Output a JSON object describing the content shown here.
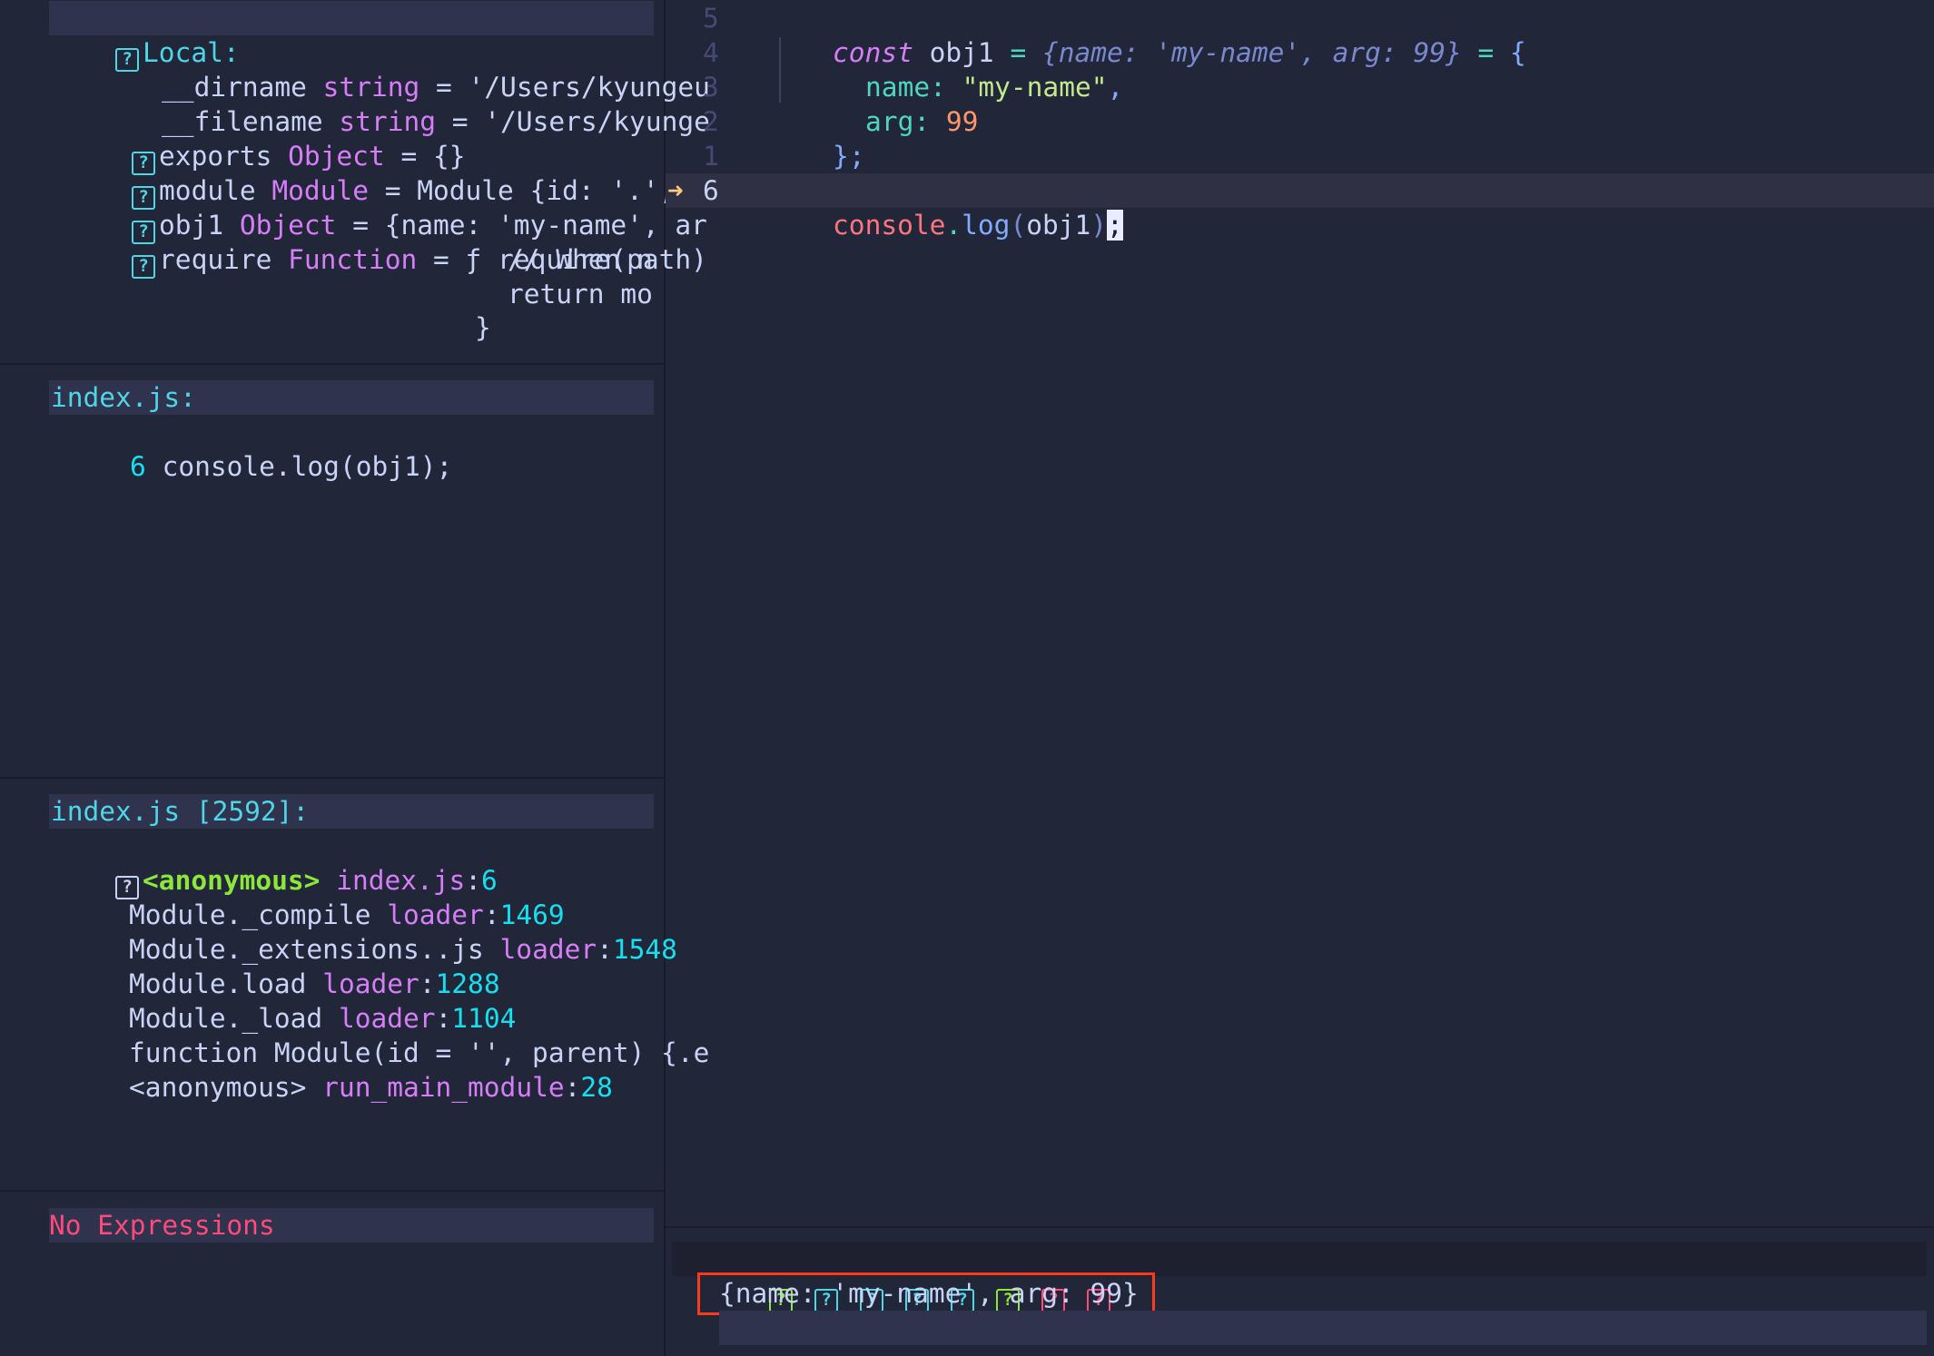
{
  "scopes": {
    "header": "Local:",
    "rows": [
      {
        "name": "__dirname",
        "type": "string",
        "value": "= '/Users/kyungeu"
      },
      {
        "name": "__filename",
        "type": "string",
        "value": "= '/Users/kyunge"
      },
      {
        "name": "exports",
        "type": "Object",
        "value": "= {}"
      },
      {
        "name": "module",
        "type": "Module",
        "value": "= Module {id: '.', p"
      },
      {
        "name": "obj1",
        "type": "Object",
        "value": "= {name: 'my-name', ar"
      },
      {
        "name": "require",
        "type": "Function",
        "value": "= ƒ require(path)"
      }
    ],
    "continuation": [
      "// When n",
      "return mo",
      "}"
    ]
  },
  "breakpoints": {
    "header": "index.js:",
    "rows": [
      {
        "line": "6",
        "code": "console.log(obj1);"
      }
    ]
  },
  "stacks": {
    "header": "index.js [2592]:",
    "rows": [
      {
        "func": "<anonymous>",
        "file": "index.js",
        "line": "6",
        "current": true
      },
      {
        "func": "Module._compile",
        "file": "loader",
        "line": "1469"
      },
      {
        "func": "Module._extensions..js",
        "file": "loader",
        "line": "1548"
      },
      {
        "func": "Module.load",
        "file": "loader",
        "line": "1288"
      },
      {
        "func": "Module._load",
        "file": "loader",
        "line": "1104"
      },
      {
        "func": "function Module(id = '', parent) {.e",
        "file": "",
        "line": ""
      },
      {
        "func": "<anonymous>",
        "file": "run_main_module",
        "line": "28"
      }
    ]
  },
  "watches": {
    "empty_text": "No Expressions"
  },
  "editor": {
    "line_numbers": [
      "5",
      "4",
      "3",
      "2",
      "1",
      "6"
    ],
    "current_line": "6",
    "code": {
      "l1": {
        "kw": "const",
        "name": "obj1",
        "eq": "=",
        "hint": "{name: 'my-name', arg: 99}",
        "eq2": "=",
        "brace": "{"
      },
      "l2": {
        "key": "name:",
        "value": "\"my-name\"",
        "comma": ","
      },
      "l3": {
        "key": "arg:",
        "value": "99"
      },
      "l4": {
        "brace": "}",
        "semi": ";"
      },
      "l6": {
        "obj": "console",
        "dot": ".",
        "method": "log",
        "lparen": "(",
        "arg": "obj1",
        "rparen": ")",
        "semi": ";"
      }
    }
  },
  "repl": {
    "toolbar_icons": [
      "step-into-icon",
      "step-over-icon",
      "step-out-icon",
      "step-back-icon",
      "run-last-icon",
      "play-icon",
      "stop-icon",
      "disconnect-icon"
    ],
    "icon_glyph": "?",
    "output": "{name: 'my-name', arg: 99}"
  },
  "colors": {
    "background": "#222639",
    "header_bg": "#2f334d",
    "highlight_box": "#ff3a1a",
    "cursor_line": "#2f3044"
  }
}
